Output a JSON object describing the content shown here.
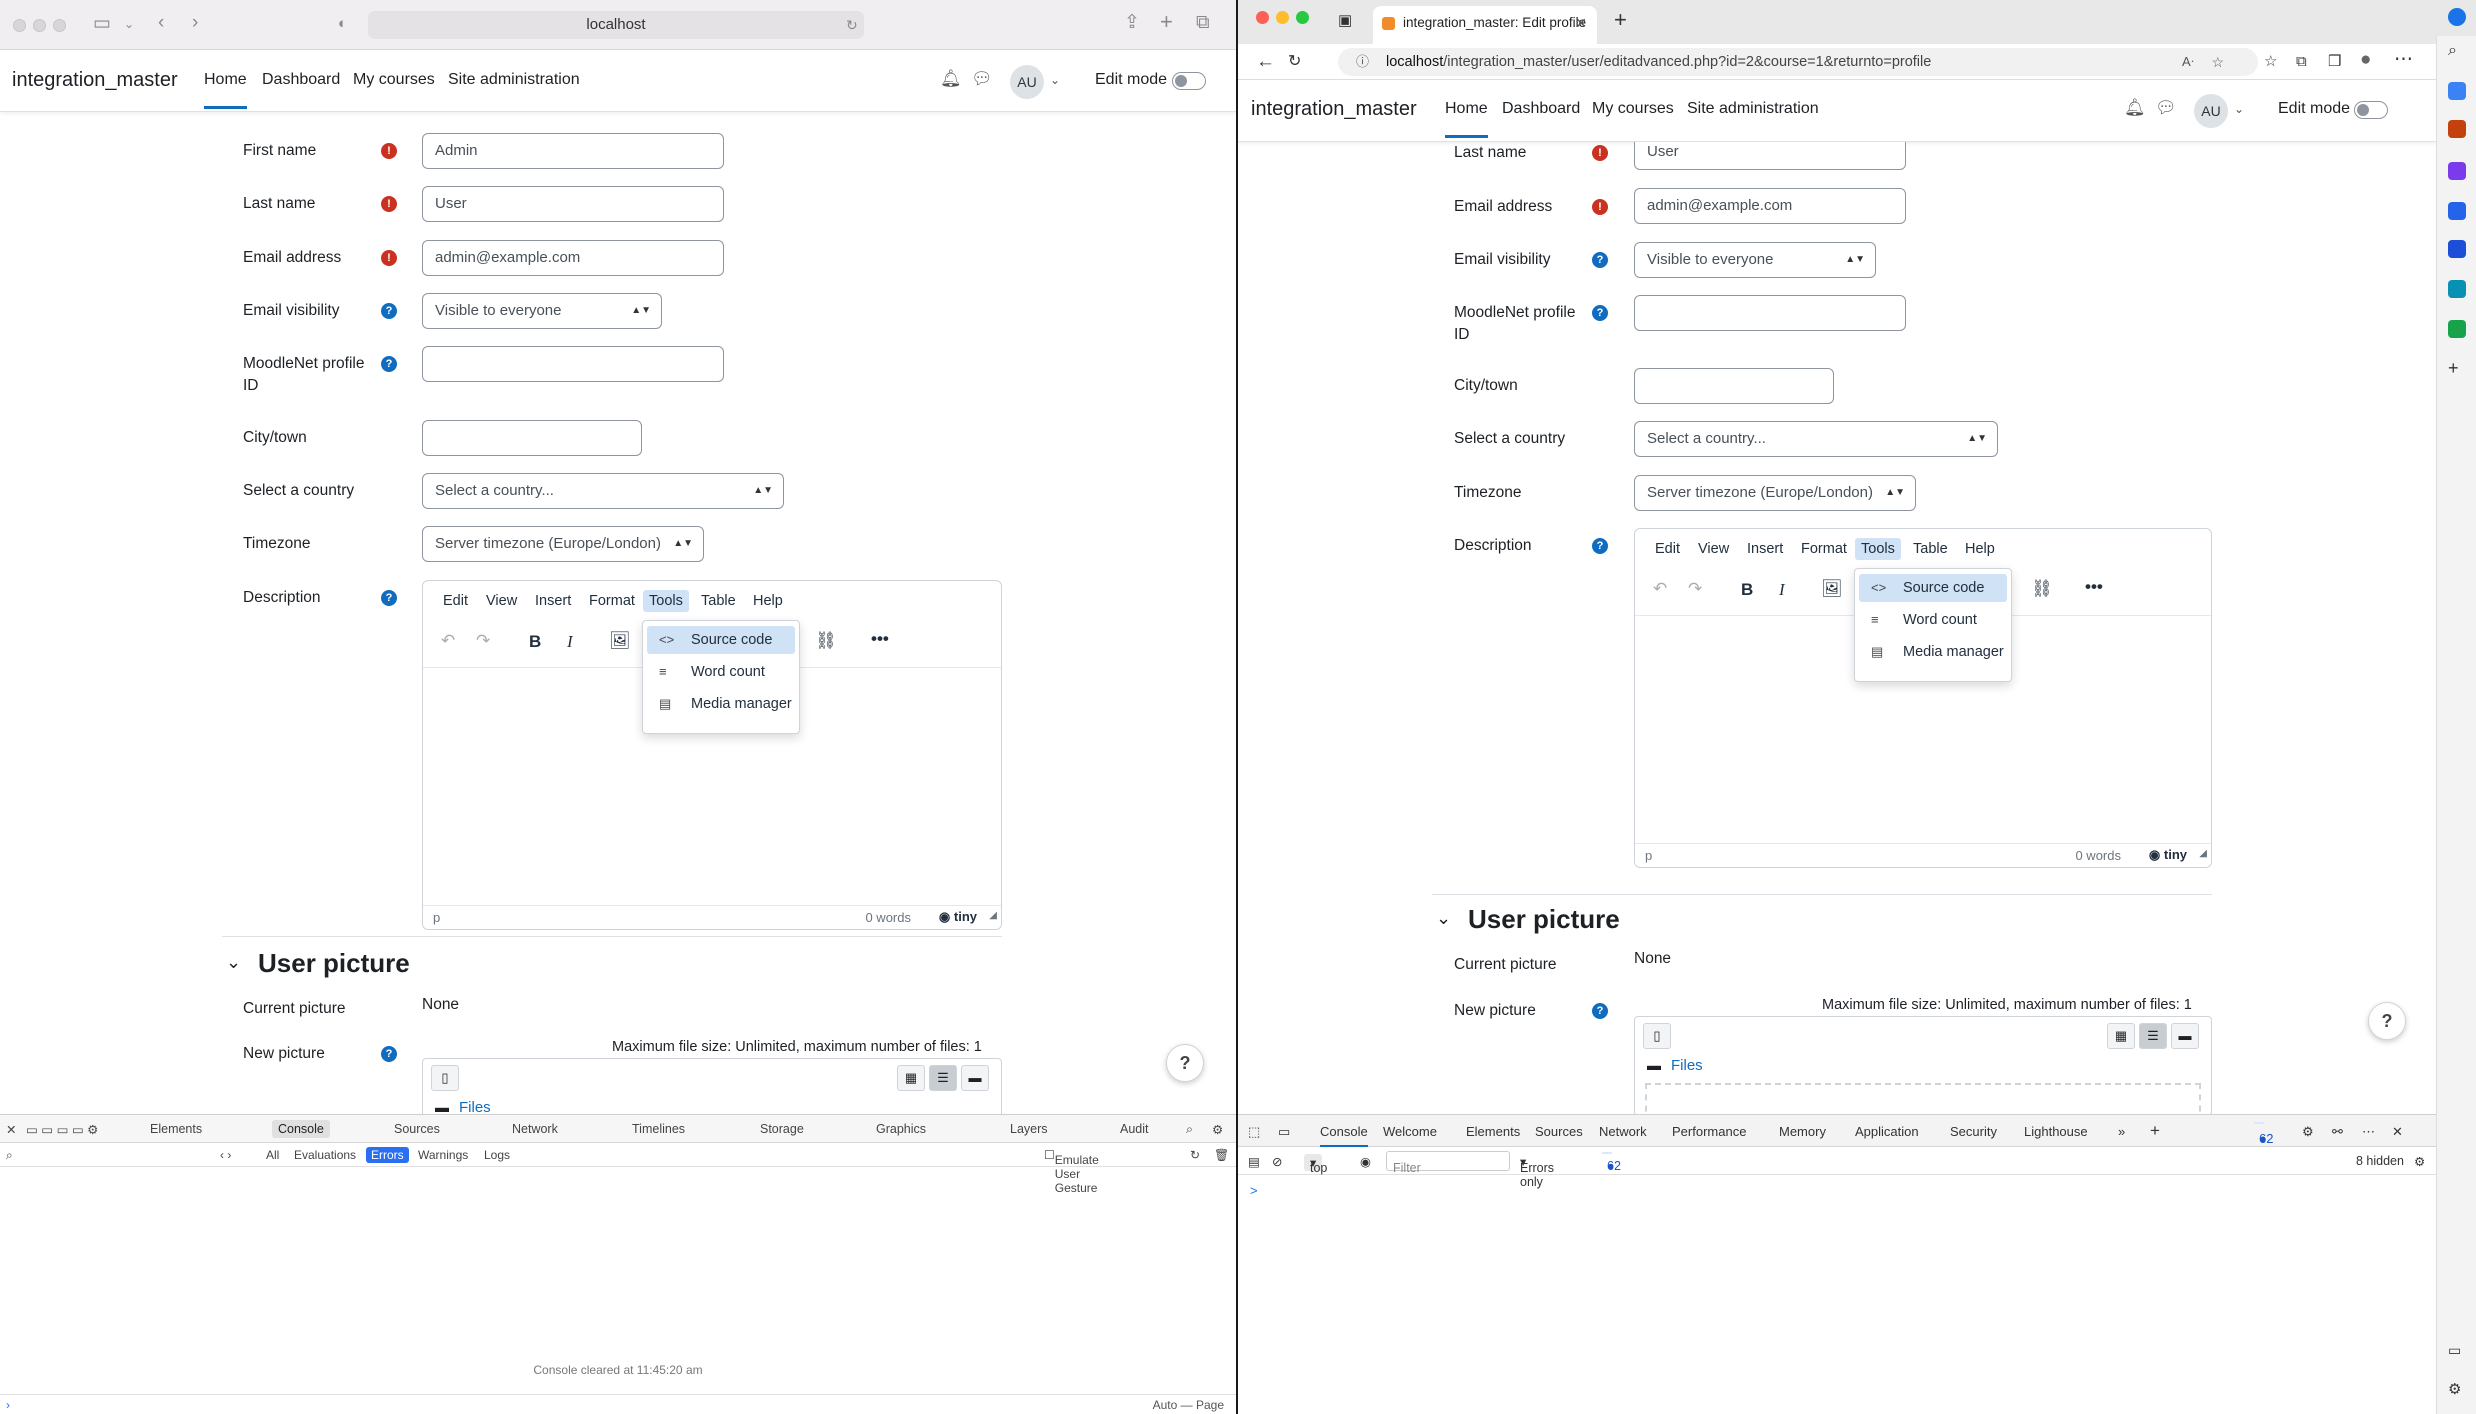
{
  "safari": {
    "url": "localhost",
    "devtools": {
      "tabs": [
        "Elements",
        "Console",
        "Sources",
        "Network",
        "Timelines",
        "Storage",
        "Graphics",
        "Layers",
        "Audit"
      ],
      "filters": [
        "All",
        "Evaluations",
        "Errors",
        "Warnings",
        "Logs"
      ],
      "emulate": "Emulate User Gesture",
      "message": "Console cleared at 11:45:20 am",
      "bottom": "Auto — Page"
    }
  },
  "edge": {
    "tab_title": "integration_master: Edit profile",
    "url_host": "localhost",
    "url_path": "/integration_master/user/editadvanced.php?id=2&course=1&returnto=profile",
    "devtools": {
      "tabs": [
        "Console",
        "Welcome",
        "Elements",
        "Sources",
        "Network",
        "Performance",
        "Memory",
        "Application",
        "Security",
        "Lighthouse"
      ],
      "context": "top",
      "filter_placeholder": "Filter",
      "level": "Errors only",
      "issues": "62",
      "hidden": "8 hidden",
      "prompt": ">"
    }
  },
  "moodle": {
    "brand": "integration_master",
    "nav": [
      "Home",
      "Dashboard",
      "My courses",
      "Site administration"
    ],
    "avatar": "AU",
    "edit_mode": "Edit mode",
    "fields": {
      "first_name": {
        "label": "First name",
        "value": "Admin"
      },
      "last_name": {
        "label": "Last name",
        "value": "User"
      },
      "email": {
        "label": "Email address",
        "value": "admin@example.com"
      },
      "email_visibility": {
        "label": "Email visibility",
        "value": "Visible to everyone"
      },
      "moodlenet": {
        "label": "MoodleNet profile ID",
        "value": ""
      },
      "city": {
        "label": "City/town",
        "value": ""
      },
      "country": {
        "label": "Select a country",
        "value": "Select a country..."
      },
      "timezone": {
        "label": "Timezone",
        "value": "Server timezone (Europe/London)"
      },
      "description": {
        "label": "Description"
      }
    },
    "editor": {
      "menus": [
        "Edit",
        "View",
        "Insert",
        "Format",
        "Tools",
        "Table",
        "Help"
      ],
      "tools_menu": [
        "Source code",
        "Word count",
        "Media manager"
      ],
      "path": "p",
      "words": "0 words",
      "brand": "tiny"
    },
    "picture": {
      "heading": "User picture",
      "current_label": "Current picture",
      "current_value": "None",
      "new_label": "New picture",
      "max_size": "Maximum file size: Unlimited, maximum number of files: 1",
      "files": "Files"
    },
    "help_fab": "?"
  }
}
